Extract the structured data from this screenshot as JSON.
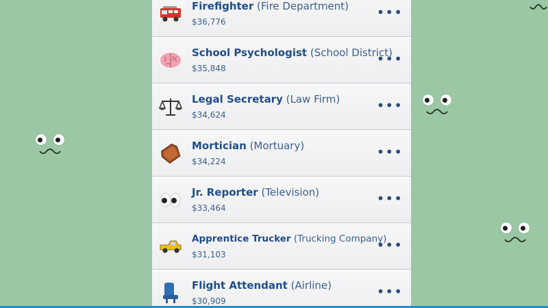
{
  "jobs": [
    {
      "title": "Firefighter",
      "org": "(Fire Department)",
      "salary": "$36,776",
      "icon": "fire-truck-icon"
    },
    {
      "title": "School Psychologist",
      "org": "(School District)",
      "salary": "$35,848",
      "icon": "brain-icon"
    },
    {
      "title": "Legal Secretary",
      "org": "(Law Firm)",
      "salary": "$34,624",
      "icon": "scales-icon"
    },
    {
      "title": "Mortician",
      "org": "(Mortuary)",
      "salary": "$34,224",
      "icon": "coffin-icon"
    },
    {
      "title": "Jr. Reporter",
      "org": "(Television)",
      "salary": "$33,464",
      "icon": "eyes-icon"
    },
    {
      "title": "Apprentice Trucker",
      "org": "(Trucking Company)",
      "salary": "$31,103",
      "icon": "pickup-truck-icon"
    },
    {
      "title": "Flight Attendant",
      "org": "(Airline)",
      "salary": "$30,909",
      "icon": "airplane-seat-icon"
    }
  ],
  "more_label": "•••",
  "colors": {
    "background": "#9cc7a4",
    "title": "#1e4e8c",
    "accent": "#1a8fd6"
  }
}
